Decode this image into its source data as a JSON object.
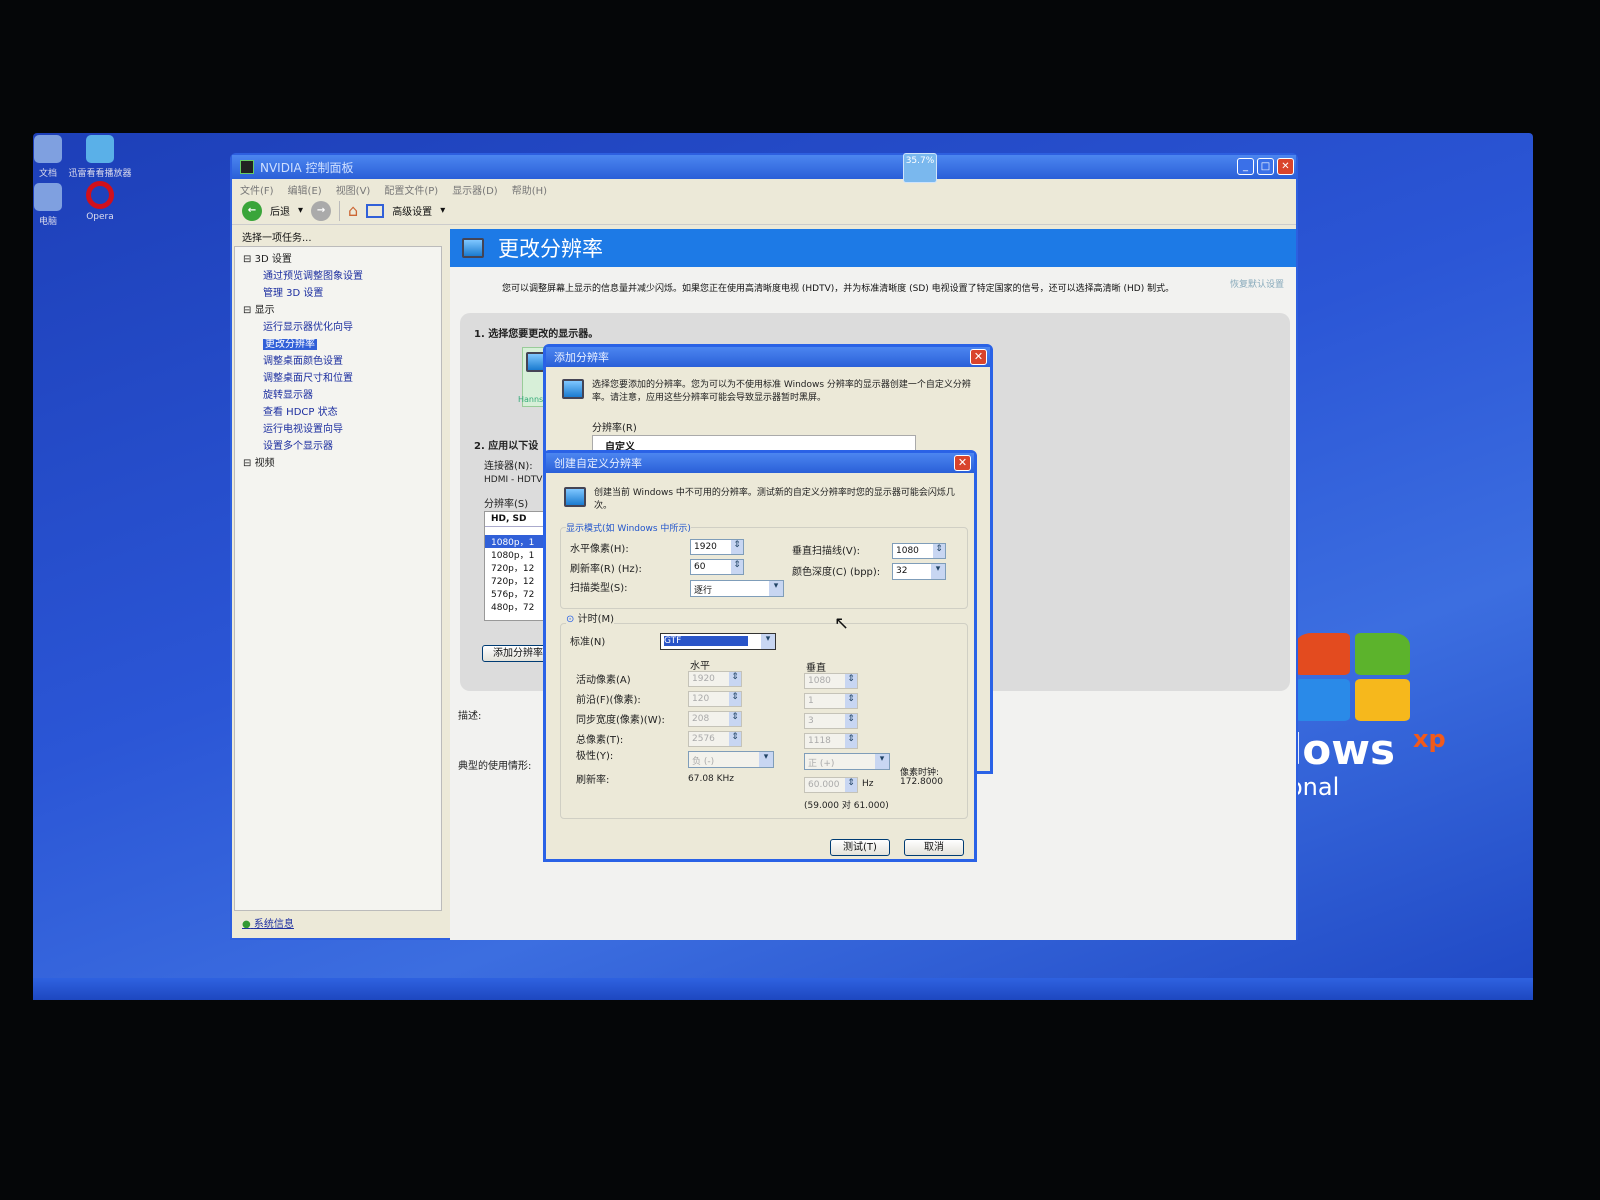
{
  "desktop": {
    "icons": [
      "文档",
      "迅雷看看播放器",
      "电脑",
      "Opera"
    ],
    "logo_text": "lows",
    "logo_sup": "xp",
    "logo_sub": "onal",
    "badge": "35.7%"
  },
  "window": {
    "title": "NVIDIA 控制面板",
    "menu": [
      "文件(F)",
      "编辑(E)",
      "视图(V)",
      "配置文件(P)",
      "显示器(D)",
      "帮助(H)"
    ],
    "toolbar": {
      "back": "后退",
      "advanced": "高级设置"
    },
    "task_label": "选择一项任务...",
    "tree": [
      {
        "label": "3D 设置",
        "root": true
      },
      {
        "label": "通过预览调整图象设置"
      },
      {
        "label": "管理 3D 设置"
      },
      {
        "label": "显示",
        "root": true
      },
      {
        "label": "运行显示器优化向导"
      },
      {
        "label": "更改分辨率",
        "selected": true
      },
      {
        "label": "调整桌面颜色设置"
      },
      {
        "label": "调整桌面尺寸和位置"
      },
      {
        "label": "旋转显示器"
      },
      {
        "label": "查看 HDCP 状态"
      },
      {
        "label": "运行电视设置向导"
      },
      {
        "label": "设置多个显示器"
      },
      {
        "label": "视频",
        "root": true
      }
    ],
    "system_info": "系统信息",
    "page_title": "更改分辨率",
    "restore": "恢复默认设置",
    "description": "您可以调整屏幕上显示的信息量并减少闪烁。如果您正在使用高清晰度电视 (HDTV)，并为标准清晰度 (SD) 电视设置了特定国家的信号，还可以选择高清晰 (HD) 制式。",
    "step1": "1. 选择您要更改的显示器。",
    "monitor_name": "Hanns",
    "step2": "2. 应用以下设",
    "connector_label": "连接器(N):",
    "connector_value": "HDMI - HDTV",
    "resolution_label": "分辨率(S)",
    "list_header": "HD, SD",
    "resolutions": [
      "1080p，1",
      "1080p，1",
      "720p，12",
      "720p，12",
      "576p，72",
      "480p，72"
    ],
    "add_button": "添加分辨率",
    "desc_label": "描述:",
    "usage_label": "典型的使用情形:"
  },
  "add_dialog": {
    "title": "添加分辨率",
    "text": "选择您要添加的分辨率。您为可以为不使用标准 Windows 分辨率的显示器创建一个自定义分辨率。请注意，应用这些分辨率可能会导致显示器暂时黑屏。",
    "res_label": "分辨率(R)",
    "res_value": "自定义"
  },
  "custom_dialog": {
    "title": "创建自定义分辨率",
    "text": "创建当前 Windows 中不可用的分辨率。测试新的自定义分辨率时您的显示器可能会闪烁几次。",
    "mode_group": "显示模式(如 Windows 中所示)",
    "h_pixels_label": "水平像素(H):",
    "h_pixels": "1920",
    "v_lines_label": "垂直扫描线(V):",
    "v_lines": "1080",
    "refresh_label": "刷新率(R) (Hz):",
    "refresh": "60",
    "depth_label": "颜色深度(C) (bpp):",
    "depth": "32",
    "scan_label": "扫描类型(S):",
    "scan": "逐行",
    "timing_label": "计时(M)",
    "standard_label": "标准(N)",
    "standard": "GTF",
    "col_h": "水平",
    "col_v": "垂直",
    "rows": [
      {
        "label": "活动像素(A)",
        "h": "1920",
        "v": "1080"
      },
      {
        "label": "前沿(F)(像素):",
        "h": "120",
        "v": "1"
      },
      {
        "label": "同步宽度(像素)(W):",
        "h": "208",
        "v": "3"
      },
      {
        "label": "总像素(T):",
        "h": "2576",
        "v": "1118"
      }
    ],
    "polarity_label": "极性(Y):",
    "polarity_h": "负 (-)",
    "polarity_v": "正 (+)",
    "rate_label": "刷新率:",
    "h_rate": "67.08 KHz",
    "v_rate": "60.000",
    "hz": "Hz",
    "range": "(59.000 对 61.000)",
    "clock_label": "像素时钟:",
    "clock": "172.8000",
    "test": "测试(T)",
    "cancel": "取消"
  }
}
